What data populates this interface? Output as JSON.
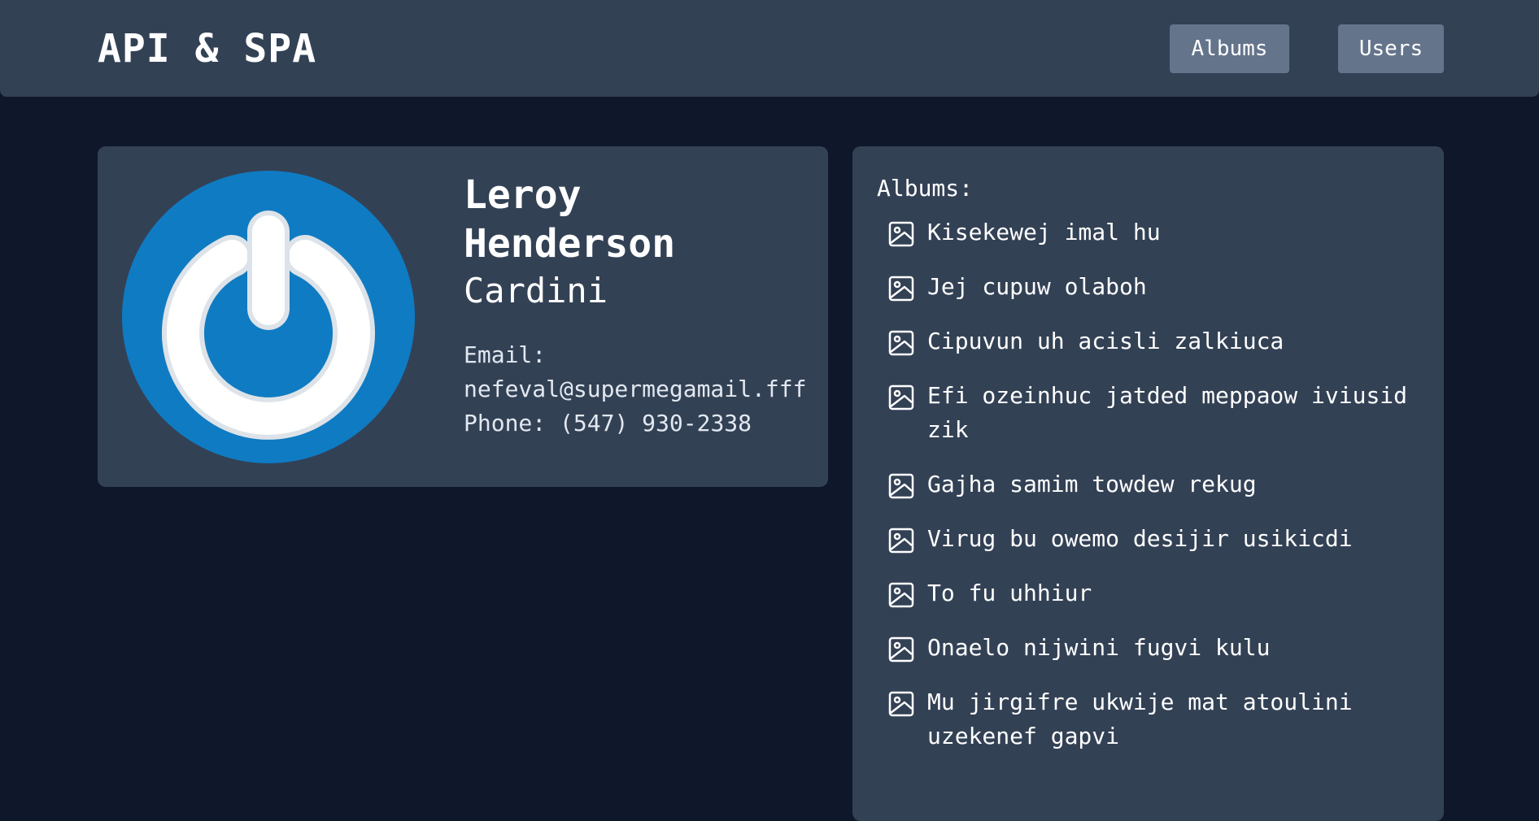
{
  "header": {
    "title": "API & SPA",
    "nav": [
      {
        "label": "Albums"
      },
      {
        "label": "Users"
      }
    ]
  },
  "user": {
    "first_name": "Leroy",
    "last_name": "Henderson",
    "company": "Cardini",
    "email_label": "Email:",
    "email": "nefeval@supermegamail.fff",
    "phone_label": "Phone:",
    "phone": "(547) 930-2338",
    "avatar_icon": "power-icon",
    "avatar_color": "#0f7bc2"
  },
  "albums": {
    "heading": "Albums:",
    "icon": "image-icon",
    "items": [
      {
        "title": "Kisekewej imal hu"
      },
      {
        "title": "Jej cupuw olaboh"
      },
      {
        "title": "Cipuvun uh acisli zalkiuca"
      },
      {
        "title": "Efi ozeinhuc jatded meppaow iviusid zik"
      },
      {
        "title": "Gajha samim towdew rekug"
      },
      {
        "title": "Virug bu owemo desijir usikicdi"
      },
      {
        "title": "To fu uhhiur"
      },
      {
        "title": "Onaelo nijwini fugvi kulu"
      },
      {
        "title": "Mu jirgifre ukwije mat atoulini uzekenef gapvi"
      }
    ]
  },
  "colors": {
    "background": "#0f172a",
    "panel": "#334155",
    "button": "#64748b"
  }
}
